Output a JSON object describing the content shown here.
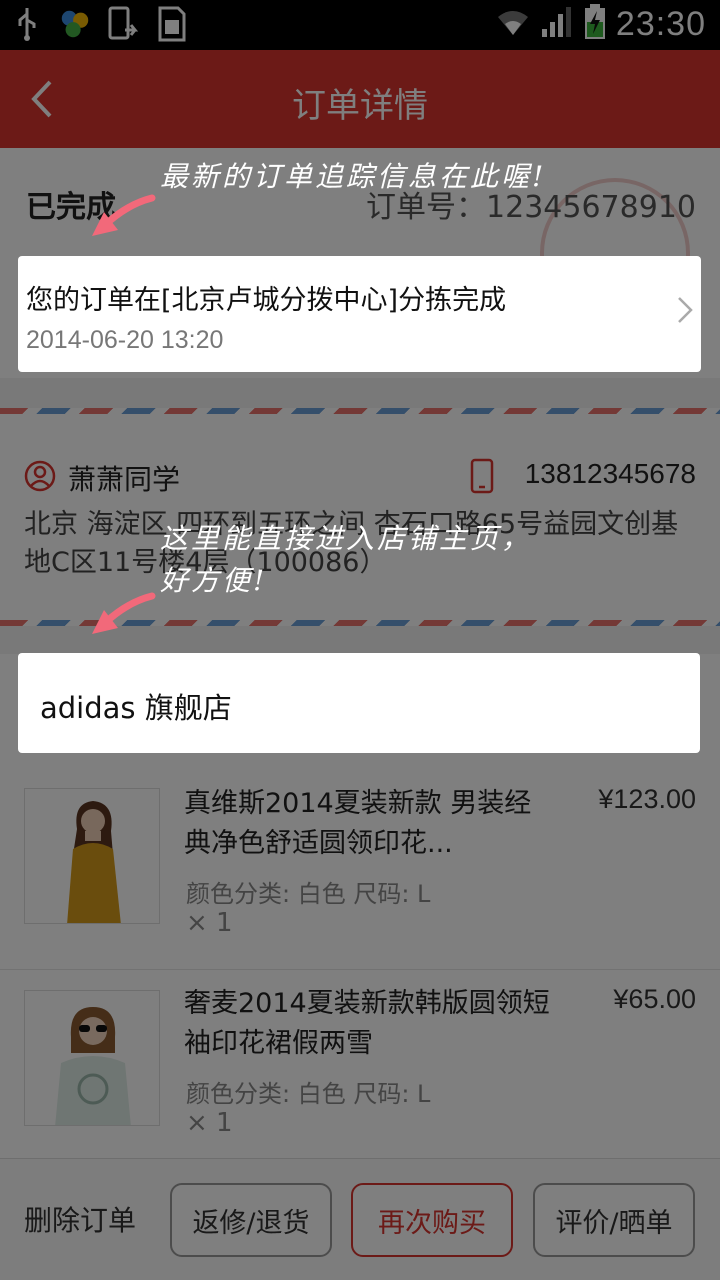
{
  "status_bar": {
    "time": "23:30",
    "icons": [
      "usb-icon",
      "app-notification-icon",
      "phone-update-icon",
      "sd-card-icon",
      "wifi-icon",
      "signal-icon",
      "battery-charging-icon"
    ]
  },
  "header": {
    "title": "订单详情",
    "back_icon": "chevron-left-icon"
  },
  "order": {
    "status": "已完成",
    "order_number": "订单号：12345678910"
  },
  "tracking": {
    "message": "您的订单在[北京卢城分拨中心]分拣完成",
    "time": "2014-06-20  13:20"
  },
  "receiver": {
    "name": "萧萧同学",
    "phone": "13812345678",
    "address": "北京 海淀区 四环到五环之间 杏石口路65号益园文创基地C区11号楼4层（100086）"
  },
  "shop": {
    "name": "adidas 旗舰店"
  },
  "products": [
    {
      "name": "真维斯2014夏装新款 男装经典净色舒适圆领印花...",
      "price": "¥123.00",
      "spec": "颜色分类: 白色 尺码: L",
      "qty": "× 1"
    },
    {
      "name": "奢麦2014夏装新款韩版圆领短袖印花裙假两雪",
      "price": "¥65.00",
      "spec": "颜色分类: 白色 尺码: L",
      "qty": "× 1"
    }
  ],
  "actions": {
    "delete": "删除订单",
    "return": "返修/退货",
    "rebuy": "再次购买",
    "review": "评价/晒单"
  },
  "annotations": {
    "tracking_note": "最新的订单追踪信息在此喔!",
    "shop_note_line1": "这里能直接进入店铺主页，",
    "shop_note_line2": "好方便!"
  },
  "colors": {
    "header_red": "#d8342f",
    "arrow_pink": "#f2697a"
  }
}
